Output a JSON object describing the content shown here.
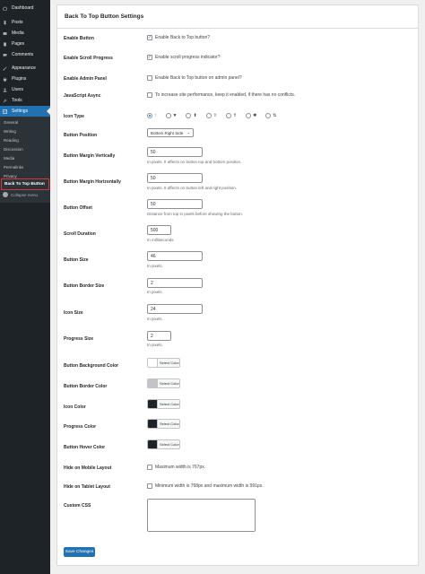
{
  "sidebar": {
    "items": [
      {
        "label": "Dashboard",
        "icon": "dashboard-icon"
      },
      {
        "label": "Posts",
        "icon": "pin-icon"
      },
      {
        "label": "Media",
        "icon": "media-icon"
      },
      {
        "label": "Pages",
        "icon": "page-icon"
      },
      {
        "label": "Comments",
        "icon": "comment-icon"
      },
      {
        "label": "Appearance",
        "icon": "brush-icon"
      },
      {
        "label": "Plugins",
        "icon": "plug-icon"
      },
      {
        "label": "Users",
        "icon": "user-icon"
      },
      {
        "label": "Tools",
        "icon": "wrench-icon"
      },
      {
        "label": "Settings",
        "icon": "settings-icon"
      }
    ],
    "submenu": [
      "General",
      "Writing",
      "Reading",
      "Discussion",
      "Media",
      "Permalinks",
      "Privacy"
    ],
    "active_sub": "Back To Top Button",
    "collapse": "Collapse menu",
    "colors": {
      "bg": "#1d2327",
      "active": "#2271b1",
      "highlight_border": "#d63638"
    }
  },
  "panel": {
    "title": "Back To Top Button Settings",
    "rows": {
      "enable_button": {
        "label": "Enable Button",
        "text": "Enable Back to Top button?",
        "checked": true
      },
      "scroll_progress": {
        "label": "Enable Scroll Progress",
        "text": "Enable scroll progress indicator?",
        "checked": true
      },
      "admin_panel": {
        "label": "Enable Admin Panel",
        "text": "Enable Back to Top button on admin panel?",
        "checked": false
      },
      "js_async": {
        "label": "JavaScript Async",
        "text": "To increase site performance, keep it enabled, if there has no conflicts.",
        "checked": false
      },
      "icon_type": {
        "label": "Icon Type",
        "options": [
          "↑",
          "▼",
          "⬆",
          "⇧",
          "⇑",
          "✱",
          "⇅"
        ],
        "selected_index": 0
      },
      "position": {
        "label": "Button Position",
        "value": "Bottom Right Side"
      },
      "margin_v": {
        "label": "Button Margin Vertically",
        "value": "50",
        "desc": "In pixels. It affects on button top and bottom position."
      },
      "margin_h": {
        "label": "Button Margin Horizontally",
        "value": "50",
        "desc": "In pixels. It affects on button left and right position."
      },
      "offset": {
        "label": "Button Offset",
        "value": "50",
        "desc": "Distance from top in pixels before showing the button."
      },
      "scroll_duration": {
        "label": "Scroll Duration",
        "value": "500",
        "desc": "In milliseconds."
      },
      "button_size": {
        "label": "Button Size",
        "value": "46",
        "desc": "In pixels."
      },
      "border_size": {
        "label": "Button Border Size",
        "value": "2",
        "desc": "In pixels."
      },
      "icon_size": {
        "label": "Icon Size",
        "value": "24",
        "desc": "In pixels."
      },
      "progress_size": {
        "label": "Progress Size",
        "value": "2",
        "desc": "In pixels."
      },
      "bg_color": {
        "label": "Button Background Color",
        "button": "Select Color",
        "color": "#ffffff"
      },
      "border_color": {
        "label": "Button Border Color",
        "button": "Select Color",
        "color": "#c3c4c7"
      },
      "icon_color": {
        "label": "Icon Color",
        "button": "Select Color",
        "color": "#1d2327"
      },
      "progress_color": {
        "label": "Progress Color",
        "button": "Select Color",
        "color": "#1d2327"
      },
      "hover_color": {
        "label": "Button Hover Color",
        "button": "Select Color",
        "color": "#1d2327"
      },
      "hide_mobile": {
        "label": "Hide on Mobile Layout",
        "text": "Maximum width is 767px.",
        "checked": false
      },
      "hide_tablet": {
        "label": "Hide on Tablet Layout",
        "text": "Minimum width is 768px and maximum width is 991px.",
        "checked": false
      },
      "custom_css": {
        "label": "Custom CSS",
        "value": ""
      }
    },
    "save_label": "Save Changes"
  }
}
